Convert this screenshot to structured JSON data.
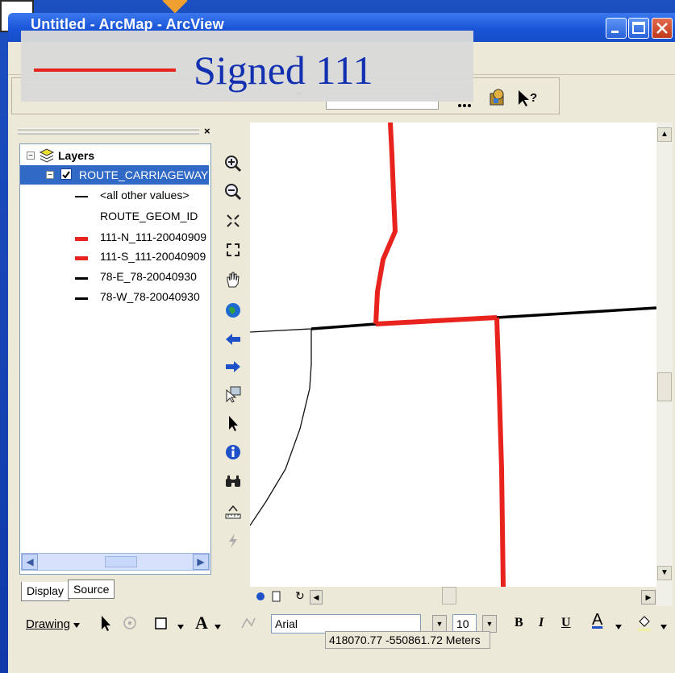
{
  "window": {
    "title": "Untitled - ArcMap - ArcView"
  },
  "banner": {
    "label": "Signed 111",
    "line_color": "#e8231d"
  },
  "toc": {
    "root": "Layers",
    "layer": "ROUTE_CARRIAGEWAY",
    "layer_checked": true,
    "legend": {
      "other_values": "<all other values>",
      "field": "ROUTE_GEOM_ID",
      "items": [
        {
          "label": "111-N_111-20040909",
          "color": "#e8231d"
        },
        {
          "label": "111-S_111-20040909",
          "color": "#e8231d"
        },
        {
          "label": "78-E_78-20040930",
          "color": "#000000"
        },
        {
          "label": "78-W_78-20040930",
          "color": "#000000"
        }
      ]
    },
    "tabs": [
      "Display",
      "Source"
    ]
  },
  "tools": {
    "items": [
      "zoom-in-icon",
      "zoom-out-icon",
      "fixed-zoom-in-icon",
      "fixed-zoom-out-icon",
      "pan-icon",
      "full-extent-icon",
      "back-extent-icon",
      "forward-extent-icon",
      "select-features-icon",
      "select-elements-icon",
      "identify-icon",
      "find-icon",
      "measure-icon",
      "hyperlink-icon"
    ]
  },
  "drawing": {
    "menu_label": "Drawing",
    "font_name": "Arial",
    "font_size": "10",
    "bold": "B",
    "italic": "I",
    "underline": "U",
    "font_color_label": "A"
  },
  "status": {
    "coordinates": "418070.77  -550861.72 Meters"
  },
  "colors": {
    "signed_route": "#e8231d",
    "route_78": "#000000",
    "selection": "#3169c6"
  }
}
